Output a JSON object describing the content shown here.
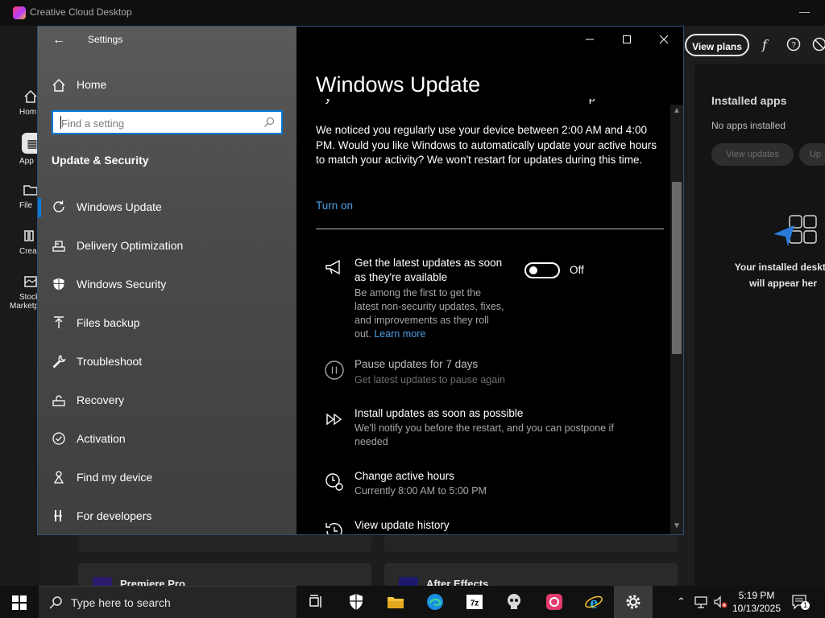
{
  "background_app": {
    "title": "Creative Cloud Desktop",
    "rail": [
      {
        "label": "Hom",
        "icon": "home-icon"
      },
      {
        "label": "App",
        "icon": "apps-icon"
      },
      {
        "label": "File",
        "icon": "folder-icon"
      },
      {
        "label": "Crea",
        "icon": "create-icon"
      },
      {
        "label": "Stock",
        "label2": "Marketp",
        "icon": "stock-icon"
      }
    ],
    "view_plans": "View plans",
    "installed_apps_title": "Installed apps",
    "no_apps": "No apps installed",
    "view_updates": "View updates",
    "update_pill": "Up",
    "installed_msg_line1": "Your installed deskto",
    "installed_msg_line2": "will appear her",
    "cards": [
      {
        "title": "Premiere Pro",
        "color": "#2d1a6b"
      },
      {
        "title": "After Effects",
        "color": "#1c1a6b"
      }
    ]
  },
  "settings": {
    "window_title": "Settings",
    "home_label": "Home",
    "search": {
      "placeholder": "Find a setting",
      "value": ""
    },
    "section_heading": "Update & Security",
    "nav": [
      {
        "label": "Windows Update",
        "icon": "refresh-icon",
        "selected": true
      },
      {
        "label": "Delivery Optimization",
        "icon": "delivery-optimization-icon",
        "selected": false
      },
      {
        "label": "Windows Security",
        "icon": "shield-icon",
        "selected": false
      },
      {
        "label": "Files backup",
        "icon": "upload-arrow-icon",
        "selected": false
      },
      {
        "label": "Troubleshoot",
        "icon": "wrench-icon",
        "selected": false
      },
      {
        "label": "Recovery",
        "icon": "recovery-icon",
        "selected": false
      },
      {
        "label": "Activation",
        "icon": "check-circle-icon",
        "selected": false
      },
      {
        "label": "Find my device",
        "icon": "person-pin-icon",
        "selected": false
      },
      {
        "label": "For developers",
        "icon": "developer-tools-icon",
        "selected": false
      }
    ],
    "page_title": "Windows Update",
    "notice": "We noticed you regularly use your device between 2:00 AM and 4:00 PM. Would you like Windows to automatically update your active hours to match your activity? We won't restart for updates during this time.",
    "turn_on": "Turn on",
    "latest_updates": {
      "title_line1": "Get the latest updates as soon",
      "title_line2": "as they're available",
      "desc_line1": "Be among the first to get the",
      "desc_line2": "latest non-security updates, fixes,",
      "desc_line3": "and improvements as they roll",
      "desc_line4": "out.",
      "learn_more": "Learn more",
      "toggle_state": "Off"
    },
    "pause": {
      "title": "Pause updates for 7 days",
      "desc": "Get latest updates to pause again"
    },
    "install": {
      "title": "Install updates as soon as possible",
      "desc_line1": "We'll notify you before the restart, and you can postpone if",
      "desc_line2": "needed"
    },
    "active_hours": {
      "title": "Change active hours",
      "desc": "Currently 8:00 AM to 5:00 PM"
    },
    "history": {
      "title": "View update history"
    }
  },
  "taskbar": {
    "search_placeholder": "Type here to search",
    "time": "5:19 PM",
    "date": "10/13/2025",
    "notification_count": "1"
  }
}
